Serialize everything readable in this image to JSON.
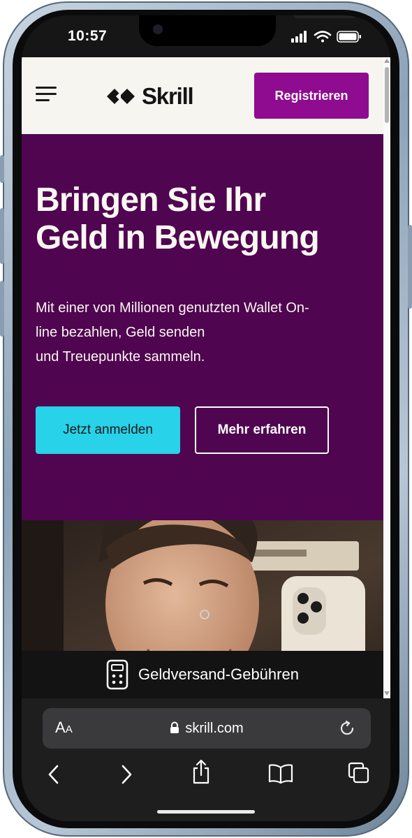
{
  "status_bar": {
    "time": "10:57",
    "icons": [
      "signal-icon",
      "wifi-icon",
      "battery-icon"
    ]
  },
  "header": {
    "logo_text": "Skrill",
    "register_label": "Registrieren"
  },
  "hero": {
    "title_line1": "Bringen Sie Ihr",
    "title_line2": "Geld in Bewegung",
    "text_line1": "Mit einer von Millionen genutzten Wallet On-",
    "text_line2": "line bezahlen, Geld senden",
    "text_line3": "und Treuepunkte sammeln.",
    "login_label": "Jetzt anmelden",
    "learn_label": "Mehr erfahren"
  },
  "fee_bar": {
    "label": "Geldversand-Gebühren",
    "icon": "calculator-icon"
  },
  "browser": {
    "aa_label_big": "A",
    "aa_label_small": "A",
    "url": "skrill.com"
  },
  "colors": {
    "brand_purple": "#4f0550",
    "register_purple": "#8f0b90",
    "login_cyan": "#28d2e8",
    "header_bg": "#f6f5f0"
  }
}
